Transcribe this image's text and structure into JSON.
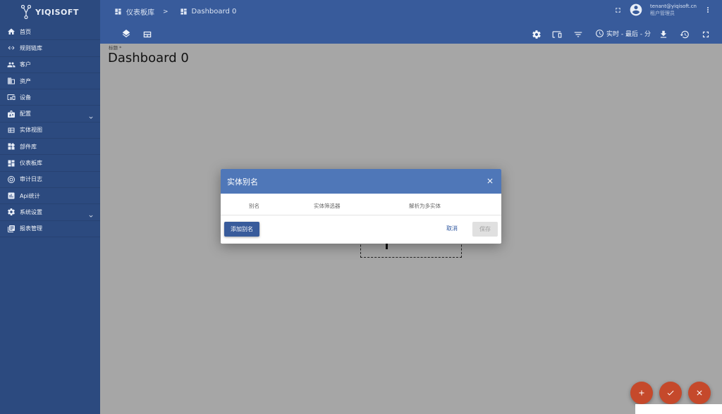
{
  "app": {
    "logo_text": "YIQISOFT"
  },
  "sidebar": {
    "items": [
      {
        "label": "首页",
        "icon": "home-icon"
      },
      {
        "label": "规则链库",
        "icon": "code-arrows-icon"
      },
      {
        "label": "客户",
        "icon": "people-icon"
      },
      {
        "label": "资产",
        "icon": "building-icon"
      },
      {
        "label": "设备",
        "icon": "devices-icon"
      },
      {
        "label": "配置",
        "icon": "profile-icon",
        "expandable": true
      },
      {
        "label": "实体视图",
        "icon": "view-icon"
      },
      {
        "label": "部件库",
        "icon": "widgets-icon"
      },
      {
        "label": "仪表板库",
        "icon": "dashboard-icon"
      },
      {
        "label": "审计日志",
        "icon": "audit-icon"
      },
      {
        "label": "Api统计",
        "icon": "chart-icon"
      },
      {
        "label": "系统设置",
        "icon": "gear-icon",
        "expandable": true
      },
      {
        "label": "报表管理",
        "icon": "report-icon"
      }
    ]
  },
  "header": {
    "breadcrumb": [
      {
        "label": "仪表板库"
      },
      {
        "label": "Dashboard 0"
      }
    ],
    "breadcrumb_sep": ">",
    "user_email": "tenant@yiqisoft.cn",
    "user_role": "租户管理员"
  },
  "toolbar": {
    "time_window": "实时 - 最后 - 分"
  },
  "main": {
    "title_label": "标题 *",
    "title_value": "Dashboard 0"
  },
  "dialog": {
    "title": "实体别名",
    "columns": [
      "别名",
      "实体筛选器",
      "解析为多实体"
    ],
    "add_label": "添加别名",
    "cancel_label": "取消",
    "save_label": "保存"
  },
  "colors": {
    "sidebar": "#2c4a7f",
    "topbar": "#385b9b",
    "dialog_header": "#4f77b8",
    "fab": "#c5492b"
  }
}
